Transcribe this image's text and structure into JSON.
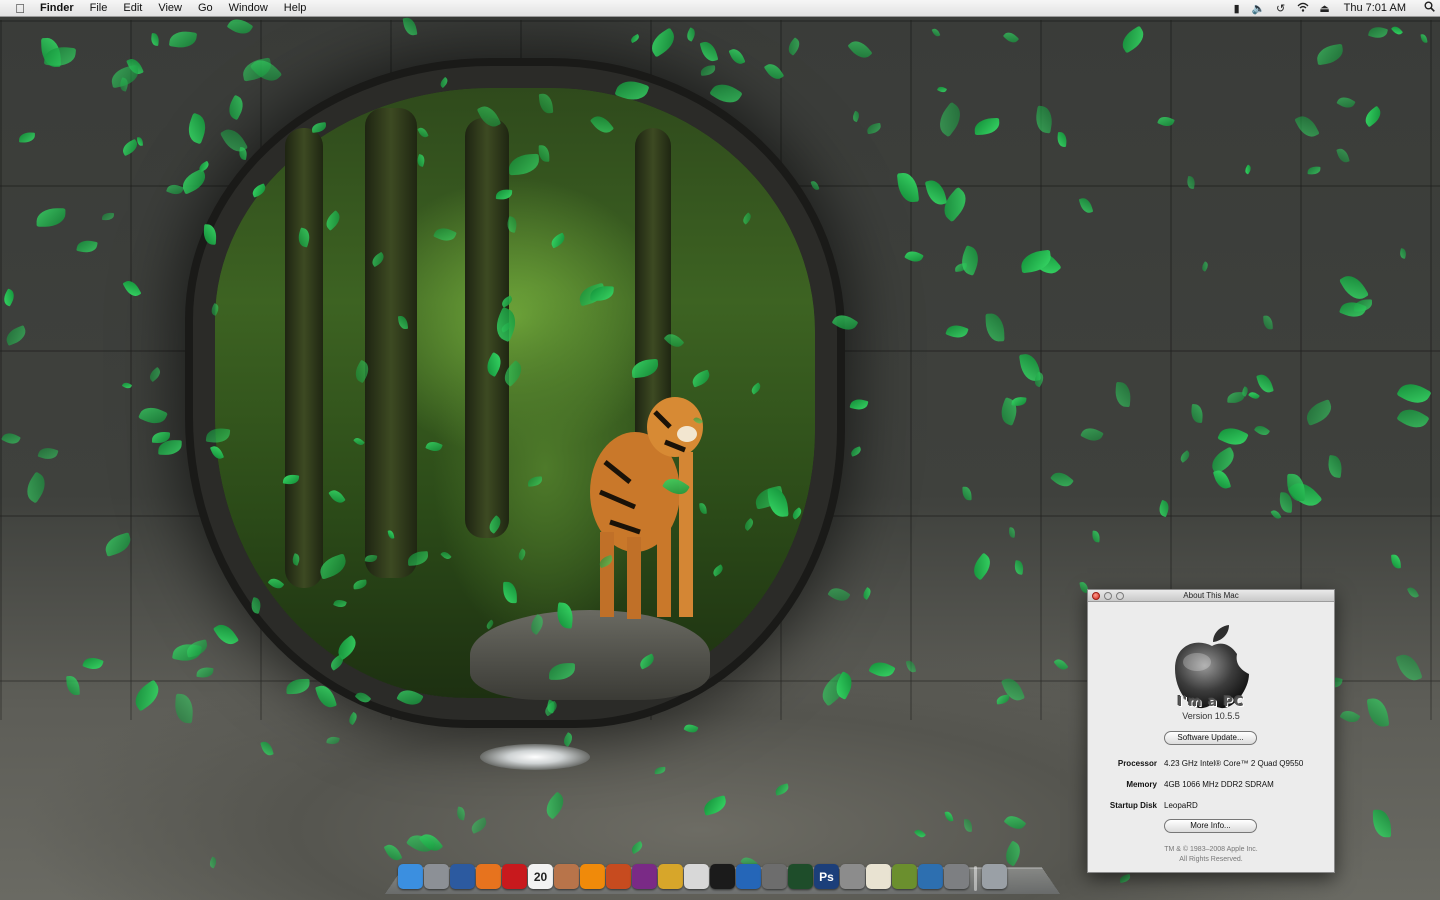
{
  "menubar": {
    "app_name": "Finder",
    "menus": [
      "File",
      "Edit",
      "View",
      "Go",
      "Window",
      "Help"
    ],
    "status_icons": [
      "menu-extra-icon",
      "volume-icon",
      "time-machine-icon",
      "wifi-icon",
      "eject-icon"
    ],
    "clock": "Thu 7:01 AM"
  },
  "desktop": {
    "wallpaper": "tiger-in-jungle-portal"
  },
  "about_window": {
    "title": "About This Mac",
    "brand": "I'm a PC",
    "version": "Version 10.5.5",
    "software_update_label": "Software Update...",
    "processor_label": "Processor",
    "processor_value": "4.23 GHz Intel® Core™ 2 Quad  Q9550",
    "memory_label": "Memory",
    "memory_value": "4GB 1066 MHz DDR2 SDRAM",
    "startup_label": "Startup Disk",
    "startup_value": "LeopaRD",
    "more_info_label": "More Info...",
    "copyright_line1": "TM & © 1983–2008 Apple Inc.",
    "copyright_line2": "All Rights Reserved."
  },
  "dock": {
    "items": [
      {
        "icon": "finder-icon",
        "color": "#3b8fe0"
      },
      {
        "icon": "dashboard-grid-icon",
        "color": "#8c9096"
      },
      {
        "icon": "photo-browser-icon",
        "color": "#2c5aa0"
      },
      {
        "icon": "firefox-icon",
        "color": "#e7731e"
      },
      {
        "icon": "acrobat-icon",
        "color": "#c8191d"
      },
      {
        "icon": "ical-icon",
        "color": "#f2f2f2",
        "text": "20"
      },
      {
        "icon": "mail-stamp-icon",
        "color": "#b8744a"
      },
      {
        "icon": "vlc-icon",
        "color": "#f08a0a"
      },
      {
        "icon": "paint-tool-icon",
        "color": "#c74b1f"
      },
      {
        "icon": "photo-booth-icon",
        "color": "#7a2a86"
      },
      {
        "icon": "dvd-icon",
        "color": "#d7a62a"
      },
      {
        "icon": "preview-icon",
        "color": "#d8d8d8"
      },
      {
        "icon": "terminal-icon",
        "color": "#1b1b1b"
      },
      {
        "icon": "xcode-icon",
        "color": "#2566b8"
      },
      {
        "icon": "printer-icon",
        "color": "#6d6d6d"
      },
      {
        "icon": "activity-monitor-icon",
        "color": "#1e4d2a"
      },
      {
        "icon": "photoshop-icon",
        "color": "#1c3f7a",
        "text": "Ps"
      },
      {
        "icon": "utilities-icon",
        "color": "#8c8c8c"
      },
      {
        "icon": "textedit-icon",
        "color": "#e9e3d2"
      },
      {
        "icon": "script-editor-icon",
        "color": "#6b8f2e"
      },
      {
        "icon": "network-icon",
        "color": "#2d6fb0"
      },
      {
        "icon": "system-preferences-icon",
        "color": "#7d7f82"
      },
      {
        "icon": "trash-icon",
        "color": "#9aa0a6"
      }
    ]
  }
}
